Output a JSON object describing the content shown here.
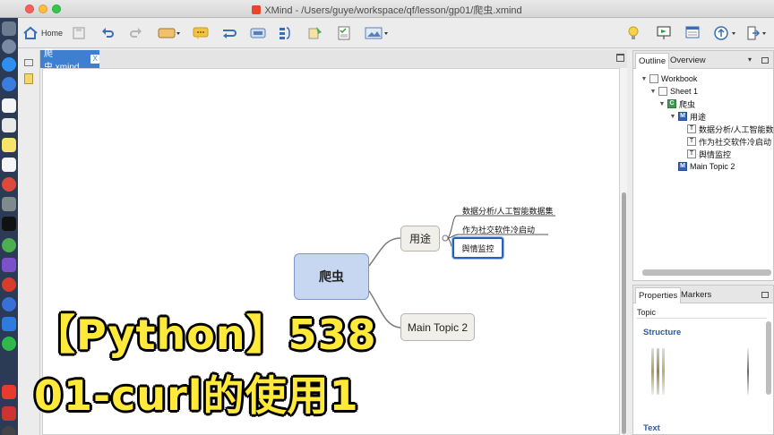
{
  "window": {
    "title": "XMind - /Users/guye/workspace/qf/lesson/gp01/爬虫.xmind"
  },
  "toolbar": {
    "home_label": "Home",
    "icons": [
      "home-icon",
      "save-icon",
      "undo-icon",
      "redo-icon",
      "topic-icon",
      "comment-icon",
      "relationship-icon",
      "boundary-icon",
      "summary-icon",
      "marker-icon",
      "task-icon",
      "image-icon",
      "idea-icon",
      "presentation-icon",
      "layout-icon",
      "upload-icon",
      "share-icon"
    ]
  },
  "editor": {
    "tab_label": "爬虫.xmind",
    "tab_close": "X"
  },
  "mindmap": {
    "central": "爬虫",
    "main_topics": [
      {
        "label": "用途",
        "subtopics": [
          "数据分析/人工智能数据集",
          "作为社交软件冷启动",
          "舆情监控"
        ]
      },
      {
        "label": "Main Topic 2"
      }
    ]
  },
  "outline": {
    "tabs": [
      "Outline",
      "Overview"
    ],
    "tree": [
      {
        "label": "Workbook",
        "icon": "workbook-icon"
      },
      {
        "label": "Sheet 1",
        "icon": "sheet-icon"
      },
      {
        "label": "爬虫",
        "icon": "C"
      },
      {
        "label": "用途",
        "icon": "M"
      },
      {
        "label": "数据分析/人工智能数据集",
        "icon": "T"
      },
      {
        "label": "作为社交软件冷启动",
        "icon": "T"
      },
      {
        "label": "舆情监控",
        "icon": "T"
      },
      {
        "label": "Main Topic 2",
        "icon": "M"
      }
    ]
  },
  "properties": {
    "tabs": [
      "Properties",
      "Markers"
    ],
    "topic_label": "Topic",
    "structure_label": "Structure",
    "text_label": "Text"
  },
  "caption": {
    "line1": "【Python】538",
    "line2": "01-curl的使用1"
  },
  "colors": {
    "accent": "#3e7fcf",
    "central_fill": "#c7d7f2",
    "caption_yellow": "#ffe93a"
  }
}
